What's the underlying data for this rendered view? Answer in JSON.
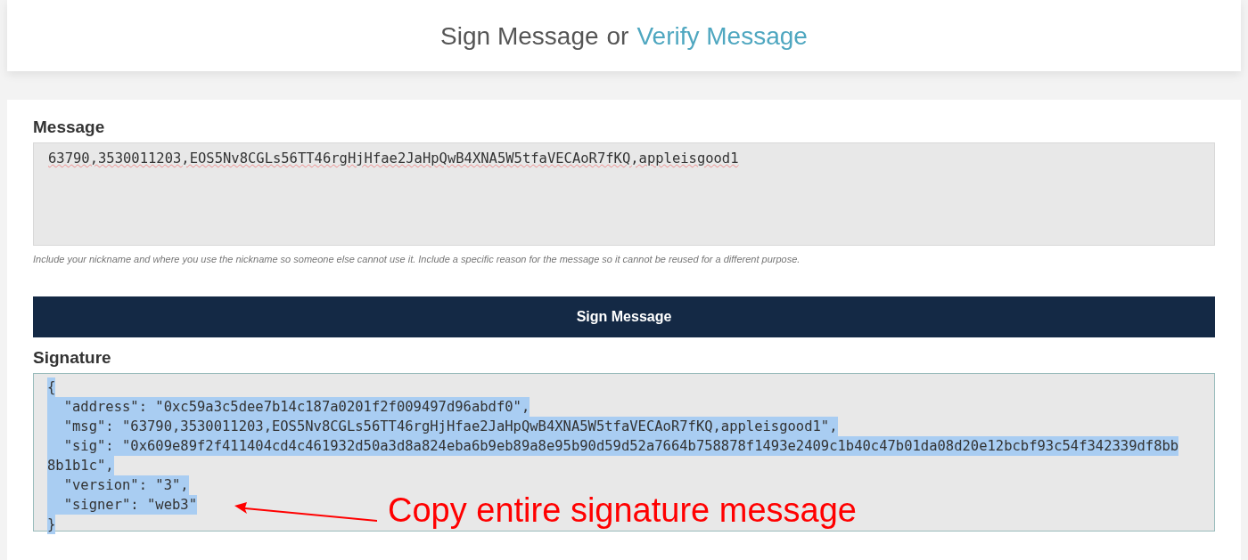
{
  "header": {
    "title": "Sign Message",
    "separator": "or",
    "link": "Verify Message"
  },
  "message": {
    "label": "Message",
    "value": "63790,3530011203,EOS5Nv8CGLs56TT46rgHjHfae2JaHpQwB4XNA5W5tfaVECAoR7fKQ,appleisgood1",
    "hint": "Include your nickname and where you use the nickname so someone else cannot use it. Include a specific reason for the message so it cannot be reused for a different purpose."
  },
  "sign_button": "Sign Message",
  "signature": {
    "label": "Signature",
    "selected": true,
    "lines": [
      "{",
      "  \"address\": \"0xc59a3c5dee7b14c187a0201f2f009497d96abdf0\",",
      "  \"msg\": \"63790,3530011203,EOS5Nv8CGLs56TT46rgHjHfae2JaHpQwB4XNA5W5tfaVECAoR7fKQ,appleisgood1\",",
      "  \"sig\": \"0x609e89f2f411404cd4c461932d50a3d8a824eba6b9eb89a8e95b90d59d52a7664b758878f1493e2409c1b40c47b01da08d20e12bcbf93c54f342339df8bb",
      "8b1b1c\",",
      "  \"version\": \"3\",",
      "  \"signer\": \"web3\"",
      "}"
    ]
  },
  "annotation": {
    "text": "Copy entire signature message"
  }
}
